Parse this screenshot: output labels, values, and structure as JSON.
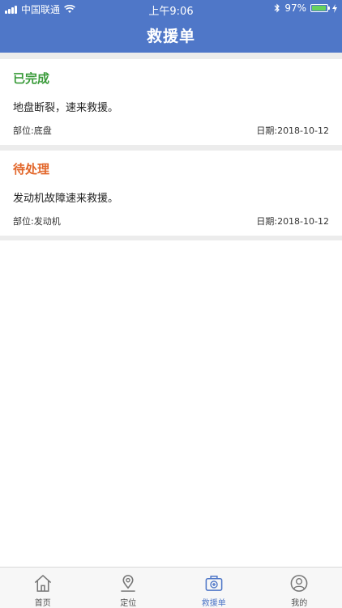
{
  "status_bar": {
    "carrier": "中国联通",
    "time": "上午9:06",
    "battery": "97%",
    "battery_level": 0.97
  },
  "header": {
    "title": "救援单"
  },
  "cards": [
    {
      "status": "已完成",
      "status_color": "#3a9b3a",
      "description": "地盘断裂，速来救援。",
      "part": "部位:底盘",
      "date": "日期:2018-10-12"
    },
    {
      "status": "待处理",
      "status_color": "#e2662a",
      "description": "发动机故障速来救援。",
      "part": "部位:发动机",
      "date": "日期:2018-10-12"
    }
  ],
  "tabs": [
    {
      "label": "首页",
      "icon": "home-icon"
    },
    {
      "label": "定位",
      "icon": "location-pin-icon"
    },
    {
      "label": "救援单",
      "icon": "medical-kit-icon",
      "active": true
    },
    {
      "label": "我的",
      "icon": "user-profile-icon"
    }
  ],
  "colors": {
    "header": "#4f77c8",
    "active_tab": "#4f77c8"
  }
}
